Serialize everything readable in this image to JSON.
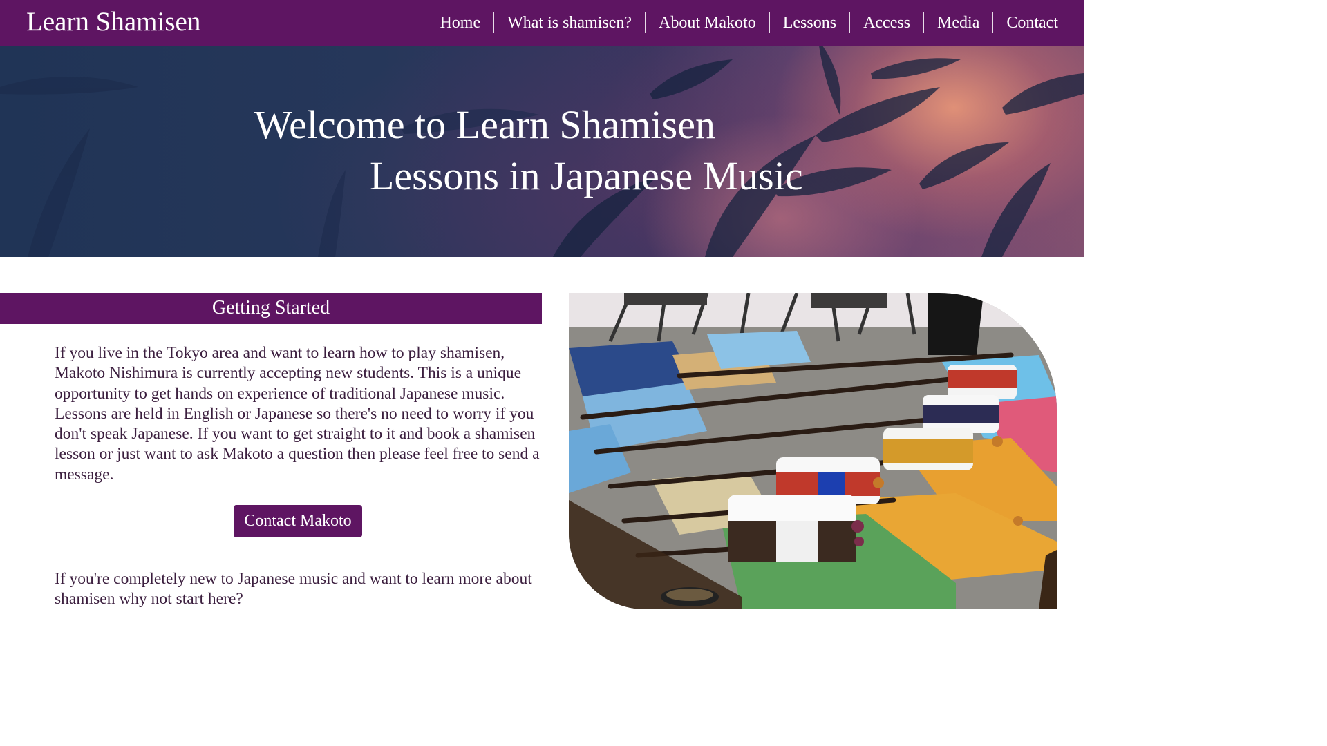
{
  "header": {
    "brand": "Learn Shamisen",
    "nav": [
      "Home",
      "What is shamisen?",
      "About Makoto",
      "Lessons",
      "Access",
      "Media",
      "Contact"
    ]
  },
  "hero": {
    "line1": "Welcome to Learn Shamisen",
    "line2": "Lessons in Japanese Music"
  },
  "main": {
    "section_title": "Getting Started",
    "intro": "If you live in the Tokyo area and want to learn how to play shamisen, Makoto Nishimura is currently accepting new students. This is a unique opportunity to get hands on experience of traditional Japanese music. Lessons are held in English or Japanese so there's no need to worry if you don't speak Japanese. If you want to get straight to it and book a shamisen lesson or just want to ask Makoto a question then please feel free to send a message.",
    "contact_button": "Contact Makoto",
    "intro2": "If you're completely new to Japanese music and want to learn more about shamisen why not start here?"
  },
  "colors": {
    "brand_purple": "#5e1562",
    "text": "#3b1e3e",
    "white": "#ffffff"
  },
  "icons": {
    "hero_background": "foliage-sunset-photo",
    "feature_image": "shamisen-on-cushions-photo"
  }
}
